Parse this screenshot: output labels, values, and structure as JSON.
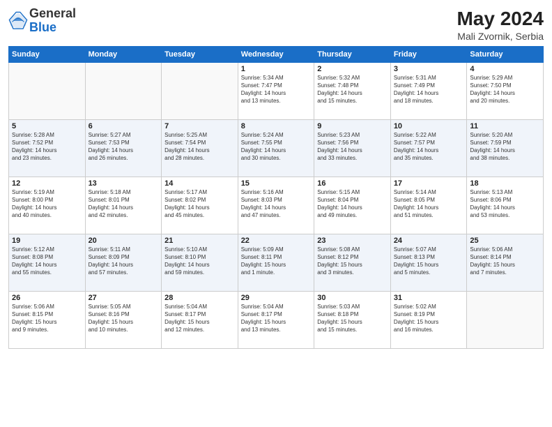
{
  "header": {
    "logo_general": "General",
    "logo_blue": "Blue",
    "month_year": "May 2024",
    "location": "Mali Zvornik, Serbia"
  },
  "days_of_week": [
    "Sunday",
    "Monday",
    "Tuesday",
    "Wednesday",
    "Thursday",
    "Friday",
    "Saturday"
  ],
  "weeks": [
    [
      {
        "day": "",
        "info": ""
      },
      {
        "day": "",
        "info": ""
      },
      {
        "day": "",
        "info": ""
      },
      {
        "day": "1",
        "info": "Sunrise: 5:34 AM\nSunset: 7:47 PM\nDaylight: 14 hours\nand 13 minutes."
      },
      {
        "day": "2",
        "info": "Sunrise: 5:32 AM\nSunset: 7:48 PM\nDaylight: 14 hours\nand 15 minutes."
      },
      {
        "day": "3",
        "info": "Sunrise: 5:31 AM\nSunset: 7:49 PM\nDaylight: 14 hours\nand 18 minutes."
      },
      {
        "day": "4",
        "info": "Sunrise: 5:29 AM\nSunset: 7:50 PM\nDaylight: 14 hours\nand 20 minutes."
      }
    ],
    [
      {
        "day": "5",
        "info": "Sunrise: 5:28 AM\nSunset: 7:52 PM\nDaylight: 14 hours\nand 23 minutes."
      },
      {
        "day": "6",
        "info": "Sunrise: 5:27 AM\nSunset: 7:53 PM\nDaylight: 14 hours\nand 26 minutes."
      },
      {
        "day": "7",
        "info": "Sunrise: 5:25 AM\nSunset: 7:54 PM\nDaylight: 14 hours\nand 28 minutes."
      },
      {
        "day": "8",
        "info": "Sunrise: 5:24 AM\nSunset: 7:55 PM\nDaylight: 14 hours\nand 30 minutes."
      },
      {
        "day": "9",
        "info": "Sunrise: 5:23 AM\nSunset: 7:56 PM\nDaylight: 14 hours\nand 33 minutes."
      },
      {
        "day": "10",
        "info": "Sunrise: 5:22 AM\nSunset: 7:57 PM\nDaylight: 14 hours\nand 35 minutes."
      },
      {
        "day": "11",
        "info": "Sunrise: 5:20 AM\nSunset: 7:59 PM\nDaylight: 14 hours\nand 38 minutes."
      }
    ],
    [
      {
        "day": "12",
        "info": "Sunrise: 5:19 AM\nSunset: 8:00 PM\nDaylight: 14 hours\nand 40 minutes."
      },
      {
        "day": "13",
        "info": "Sunrise: 5:18 AM\nSunset: 8:01 PM\nDaylight: 14 hours\nand 42 minutes."
      },
      {
        "day": "14",
        "info": "Sunrise: 5:17 AM\nSunset: 8:02 PM\nDaylight: 14 hours\nand 45 minutes."
      },
      {
        "day": "15",
        "info": "Sunrise: 5:16 AM\nSunset: 8:03 PM\nDaylight: 14 hours\nand 47 minutes."
      },
      {
        "day": "16",
        "info": "Sunrise: 5:15 AM\nSunset: 8:04 PM\nDaylight: 14 hours\nand 49 minutes."
      },
      {
        "day": "17",
        "info": "Sunrise: 5:14 AM\nSunset: 8:05 PM\nDaylight: 14 hours\nand 51 minutes."
      },
      {
        "day": "18",
        "info": "Sunrise: 5:13 AM\nSunset: 8:06 PM\nDaylight: 14 hours\nand 53 minutes."
      }
    ],
    [
      {
        "day": "19",
        "info": "Sunrise: 5:12 AM\nSunset: 8:08 PM\nDaylight: 14 hours\nand 55 minutes."
      },
      {
        "day": "20",
        "info": "Sunrise: 5:11 AM\nSunset: 8:09 PM\nDaylight: 14 hours\nand 57 minutes."
      },
      {
        "day": "21",
        "info": "Sunrise: 5:10 AM\nSunset: 8:10 PM\nDaylight: 14 hours\nand 59 minutes."
      },
      {
        "day": "22",
        "info": "Sunrise: 5:09 AM\nSunset: 8:11 PM\nDaylight: 15 hours\nand 1 minute."
      },
      {
        "day": "23",
        "info": "Sunrise: 5:08 AM\nSunset: 8:12 PM\nDaylight: 15 hours\nand 3 minutes."
      },
      {
        "day": "24",
        "info": "Sunrise: 5:07 AM\nSunset: 8:13 PM\nDaylight: 15 hours\nand 5 minutes."
      },
      {
        "day": "25",
        "info": "Sunrise: 5:06 AM\nSunset: 8:14 PM\nDaylight: 15 hours\nand 7 minutes."
      }
    ],
    [
      {
        "day": "26",
        "info": "Sunrise: 5:06 AM\nSunset: 8:15 PM\nDaylight: 15 hours\nand 9 minutes."
      },
      {
        "day": "27",
        "info": "Sunrise: 5:05 AM\nSunset: 8:16 PM\nDaylight: 15 hours\nand 10 minutes."
      },
      {
        "day": "28",
        "info": "Sunrise: 5:04 AM\nSunset: 8:17 PM\nDaylight: 15 hours\nand 12 minutes."
      },
      {
        "day": "29",
        "info": "Sunrise: 5:04 AM\nSunset: 8:17 PM\nDaylight: 15 hours\nand 13 minutes."
      },
      {
        "day": "30",
        "info": "Sunrise: 5:03 AM\nSunset: 8:18 PM\nDaylight: 15 hours\nand 15 minutes."
      },
      {
        "day": "31",
        "info": "Sunrise: 5:02 AM\nSunset: 8:19 PM\nDaylight: 15 hours\nand 16 minutes."
      },
      {
        "day": "",
        "info": ""
      }
    ]
  ]
}
